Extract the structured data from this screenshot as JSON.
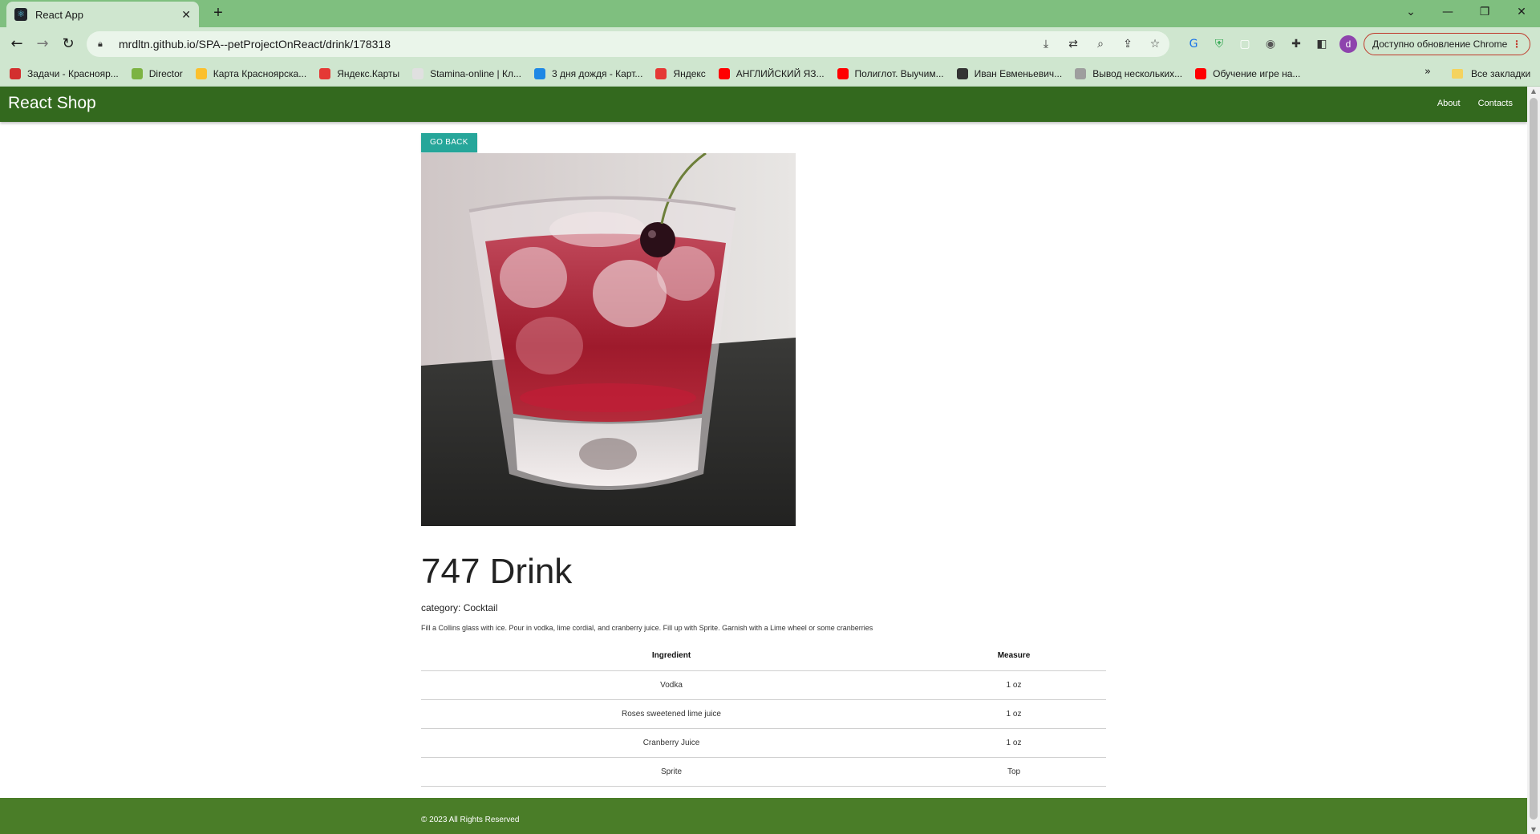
{
  "browser": {
    "tab_title": "React App",
    "tab_close": "✕",
    "new_tab": "+",
    "url": "mrdltn.github.io/SPA--petProjectOnReact/drink/178318",
    "profile_letter": "d",
    "update_label": "Доступно обновление Chrome",
    "window_controls": {
      "list": "⌄",
      "minimize": "—",
      "restore": "❐",
      "close": "✕"
    },
    "bookmarks": [
      {
        "label": "Задачи - Краснояр...",
        "color": "#d32f2f"
      },
      {
        "label": "Director",
        "color": "#7cb342"
      },
      {
        "label": "Карта Красноярска...",
        "color": "#fbc02d"
      },
      {
        "label": "Яндекс.Карты",
        "color": "#e53935"
      },
      {
        "label": "Stamina-online | Кл...",
        "color": "#e0e0e0"
      },
      {
        "label": "3 дня дождя - Карт...",
        "color": "#1e88e5"
      },
      {
        "label": "Яндекс",
        "color": "#e53935"
      },
      {
        "label": "АНГЛИЙСКИЙ ЯЗ...",
        "color": "#ff0000"
      },
      {
        "label": "Полиглот. Выучим...",
        "color": "#ff0000"
      },
      {
        "label": "Иван Евменьевич...",
        "color": "#333333"
      },
      {
        "label": "Вывод нескольких...",
        "color": "#9e9e9e"
      },
      {
        "label": "Обучение игре на...",
        "color": "#ff0000"
      }
    ],
    "bookmarks_more": "»",
    "all_bookmarks": "Все закладки"
  },
  "site": {
    "brand": "React Shop",
    "nav": {
      "about": "About",
      "contacts": "Contacts"
    },
    "footer_text": "© 2023 All Rights Reserved"
  },
  "drink": {
    "go_back": "GO BACK",
    "name": "747 Drink",
    "category_label": "category:",
    "category": "Cocktail",
    "instructions": "Fill a Collins glass with ice. Pour in vodka, lime cordial, and cranberry juice. Fill up with Sprite. Garnish with a Lime wheel or some cranberries",
    "table_headers": {
      "ingredient": "Ingredient",
      "measure": "Measure"
    },
    "ingredients": [
      {
        "name": "Vodka",
        "measure": "1 oz"
      },
      {
        "name": "Roses sweetened lime juice",
        "measure": "1 oz"
      },
      {
        "name": "Cranberry Juice",
        "measure": "1 oz"
      },
      {
        "name": "Sprite",
        "measure": "Top"
      }
    ]
  },
  "colors": {
    "navbar": "#33691e",
    "footer": "#4a7d28",
    "button": "#26a69a",
    "browser_frame": "#7fbf7f"
  }
}
